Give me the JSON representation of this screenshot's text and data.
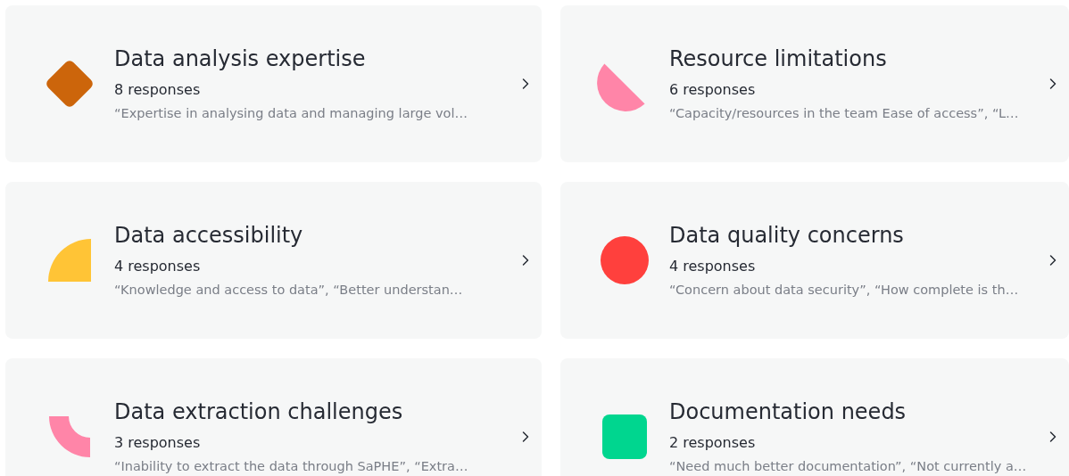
{
  "themes": [
    {
      "title": "Data analysis expertise",
      "count": "8 responses",
      "quote": "“Expertise in analysing data and managing large vol…",
      "kind": "diamond",
      "color": "#cc650b"
    },
    {
      "title": "Resource limitations",
      "count": "6 responses",
      "quote": "“Capacity/resources in the team Ease of access”, “L…",
      "kind": "half-circle",
      "color": "#ff85a8"
    },
    {
      "title": "Data accessibility",
      "count": "4 responses",
      "quote": "“Knowledge and access to data”, “Better understan…",
      "kind": "quarter-circle",
      "color": "#ffc436"
    },
    {
      "title": "Data quality concerns",
      "count": "4 responses",
      "quote": "“Concern about data security”, “How complete is th…",
      "kind": "circle",
      "color": "#ff403d"
    },
    {
      "title": "Data extraction challenges",
      "count": "3 responses",
      "quote": "“Inability to extract the data through SaPHE”, “Extra…",
      "kind": "arc",
      "color": "#ff85a8"
    },
    {
      "title": "Documentation needs",
      "count": "2 responses",
      "quote": "“Need much better documentation”, “Not currently a…",
      "kind": "square",
      "color": "#00d68f"
    }
  ]
}
